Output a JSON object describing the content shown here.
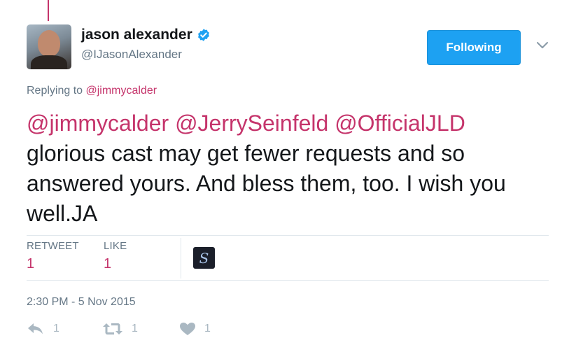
{
  "author": {
    "name": "jason alexander",
    "handle": "@IJasonAlexander",
    "verified": true
  },
  "follow_button": {
    "label": "Following"
  },
  "reply": {
    "prefix": "Replying to",
    "to": "@jimmycalder"
  },
  "tweet": {
    "mentions": "@jimmycalder @JerrySeinfeld @OfficialJLD",
    "body": "glorious cast may get fewer requests and so answered yours. And bless them, too. I wish you well.JA"
  },
  "stats": {
    "retweet_label": "RETWEET",
    "retweet_count": "1",
    "like_label": "LIKE",
    "like_count": "1"
  },
  "liker": {
    "initial": "S"
  },
  "timestamp": "2:30 PM - 5 Nov 2015",
  "actions": {
    "reply_count": "1",
    "retweet_count": "1",
    "like_count": "1"
  },
  "colors": {
    "link": "#c5346b",
    "follow_button": "#1da1f2",
    "secondary_text": "#657786",
    "icon": "#aab8c2"
  }
}
